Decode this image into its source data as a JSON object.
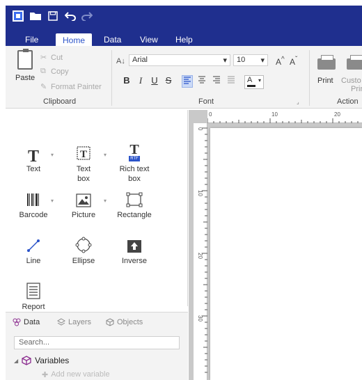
{
  "quick_access": {
    "app_icon": "app-logo-icon",
    "open_icon": "folder-icon",
    "save_icon": "save-icon",
    "undo_icon": "undo-icon",
    "redo_icon": "redo-icon"
  },
  "menu": {
    "tabs": [
      {
        "label": "File"
      },
      {
        "label": "Home"
      },
      {
        "label": "Data"
      },
      {
        "label": "View"
      },
      {
        "label": "Help"
      }
    ],
    "active": "Home"
  },
  "ribbon": {
    "clipboard": {
      "paste": "Paste",
      "cut": "Cut",
      "copy": "Copy",
      "format_painter": "Format Painter",
      "label": "Clipboard"
    },
    "font": {
      "family": "Arial",
      "size": "10",
      "bold": "B",
      "italic": "I",
      "underline": "U",
      "strike": "S",
      "color_letter": "A",
      "label": "Font"
    },
    "action": {
      "print": "Print",
      "custom_print_line1": "Custo",
      "custom_print_line2": "Prin",
      "label": "Action"
    }
  },
  "toolbox": {
    "items": [
      {
        "label_1": "Text",
        "label_2": ""
      },
      {
        "label_1": "Text",
        "label_2": "box"
      },
      {
        "label_1": "Rich text",
        "label_2": "box"
      },
      {
        "label_1": "Barcode",
        "label_2": ""
      },
      {
        "label_1": "Picture",
        "label_2": ""
      },
      {
        "label_1": "Rectangle",
        "label_2": ""
      },
      {
        "label_1": "Line",
        "label_2": ""
      },
      {
        "label_1": "Ellipse",
        "label_2": ""
      },
      {
        "label_1": "Inverse",
        "label_2": ""
      },
      {
        "label_1": "Report",
        "label_2": ""
      }
    ],
    "rtf_badge": "RTF"
  },
  "bottom_panel": {
    "tabs": [
      {
        "label": "Data"
      },
      {
        "label": "Layers"
      },
      {
        "label": "Objects"
      }
    ],
    "search_placeholder": "Search...",
    "tree": {
      "root": "Variables",
      "add": "Add new variable"
    }
  },
  "ruler": {
    "top_ticks": [
      "0",
      "10",
      "20"
    ],
    "left_ticks": [
      "0",
      "10",
      "20",
      "30"
    ]
  },
  "colors": {
    "title_bar": "#1f2f8e",
    "accent": "#2b53c9",
    "ribbon_bg": "#f3f3f3",
    "canvas_bg": "#c9c9c9",
    "variables_icon": "#8b2c8f"
  }
}
